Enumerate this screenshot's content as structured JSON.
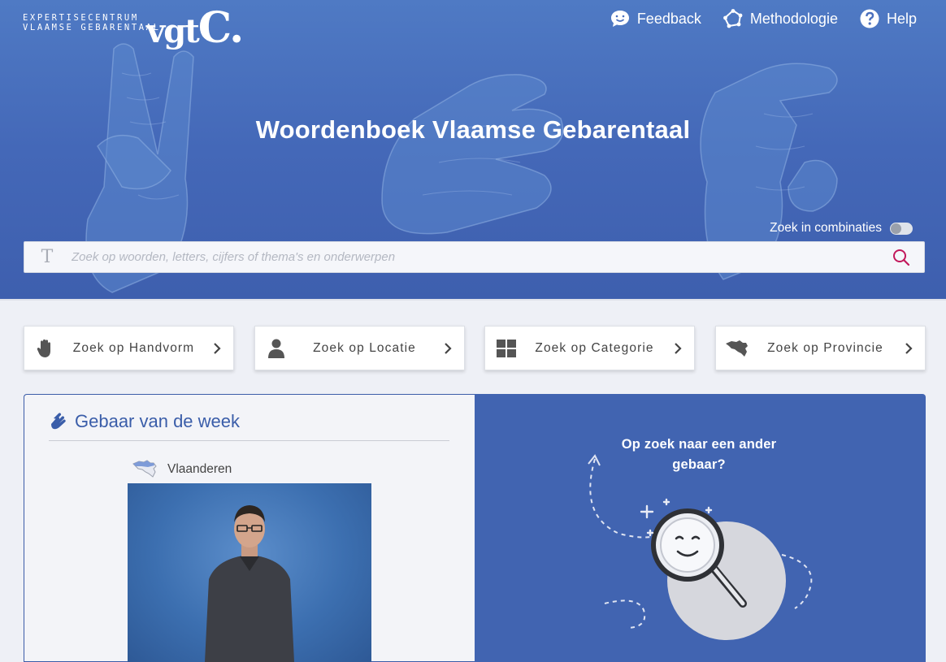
{
  "header": {
    "logo_line1": "EXPERTISECENTRUM",
    "logo_line2": "VLAAMSE GEBARENTAAL",
    "logo_mark": "vgt",
    "logo_mark_big": "C.",
    "nav": [
      {
        "label": "Feedback",
        "icon": "chat-smile-icon"
      },
      {
        "label": "Methodologie",
        "icon": "network-icon"
      },
      {
        "label": "Help",
        "icon": "question-circle-icon"
      }
    ]
  },
  "hero": {
    "title": "Woordenboek Vlaamse Gebarentaal",
    "combo_label": "Zoek in combinaties",
    "combo_enabled": false
  },
  "search": {
    "placeholder": "Zoek op woorden, letters, cijfers of thema's en onderwerpen",
    "value": "",
    "left_icon": "T"
  },
  "categories": [
    {
      "label": "Zoek op Handvorm",
      "icon": "hand-icon"
    },
    {
      "label": "Zoek op Locatie",
      "icon": "person-icon"
    },
    {
      "label": "Zoek op Categorie",
      "icon": "grid-icon"
    },
    {
      "label": "Zoek op Provincie",
      "icon": "belgium-map-icon"
    }
  ],
  "week": {
    "title": "Gebaar van de week",
    "region": "Vlaanderen"
  },
  "other": {
    "text": "Op zoek naar een ander gebaar?"
  },
  "colors": {
    "hero": "#4468b8",
    "accent_blue": "#3a5da9",
    "search_icon": "#c2185b",
    "card_blue": "#4164b1"
  }
}
